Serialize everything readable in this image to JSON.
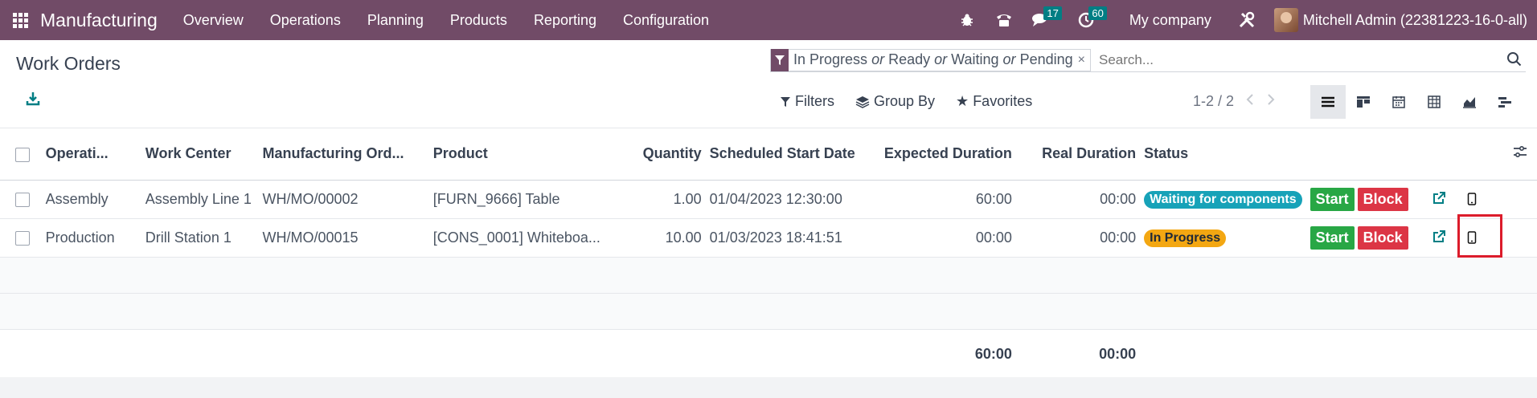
{
  "navbar": {
    "brand": "Manufacturing",
    "menu": [
      "Overview",
      "Operations",
      "Planning",
      "Products",
      "Reporting",
      "Configuration"
    ],
    "icons": [
      "bug-icon",
      "phone-icon",
      "chat-icon",
      "clock-icon",
      "tools-icon"
    ],
    "messages_count": "17",
    "activities_count": "60",
    "company": "My company",
    "user": "Mitchell Admin (22381223-16-0-all)"
  },
  "control": {
    "title": "Work Orders",
    "facet_parts": [
      "In Progress",
      "or",
      "Ready",
      "or",
      "Waiting",
      "or",
      "Pending"
    ],
    "facet_close": "×",
    "search_placeholder": "Search...",
    "filters_label": "Filters",
    "groupby_label": "Group By",
    "favorites_label": "Favorites",
    "pager": "1-2 / 2"
  },
  "table": {
    "headers": {
      "operation": "Operati...",
      "work_center": "Work Center",
      "mo": "Manufacturing Ord...",
      "product": "Product",
      "quantity": "Quantity",
      "start_date": "Scheduled Start Date",
      "expected": "Expected Duration",
      "real": "Real Duration",
      "status": "Status"
    },
    "rows": [
      {
        "operation": "Assembly",
        "work_center": "Assembly Line 1",
        "mo": "WH/MO/00002",
        "product": "[FURN_9666] Table",
        "quantity": "1.00",
        "start_date": "01/04/2023 12:30:00",
        "expected": "60:00",
        "real": "00:00",
        "status": "Waiting for components",
        "start_label": "Start",
        "block_label": "Block"
      },
      {
        "operation": "Production",
        "work_center": "Drill Station 1",
        "mo": "WH/MO/00015",
        "product": "[CONS_0001] Whiteboa...",
        "quantity": "10.00",
        "start_date": "01/03/2023 18:41:51",
        "expected": "00:00",
        "real": "00:00",
        "status": "In Progress",
        "start_label": "Start",
        "block_label": "Block"
      }
    ],
    "totals": {
      "expected": "60:00",
      "real": "00:00"
    }
  },
  "colors": {
    "brand": "#714b67",
    "badge": "#017e84",
    "waiting": "#17a2b8",
    "in_progress": "#f3a712",
    "start": "#28a745",
    "block": "#dc3545",
    "highlight": "#dc1c2b"
  }
}
